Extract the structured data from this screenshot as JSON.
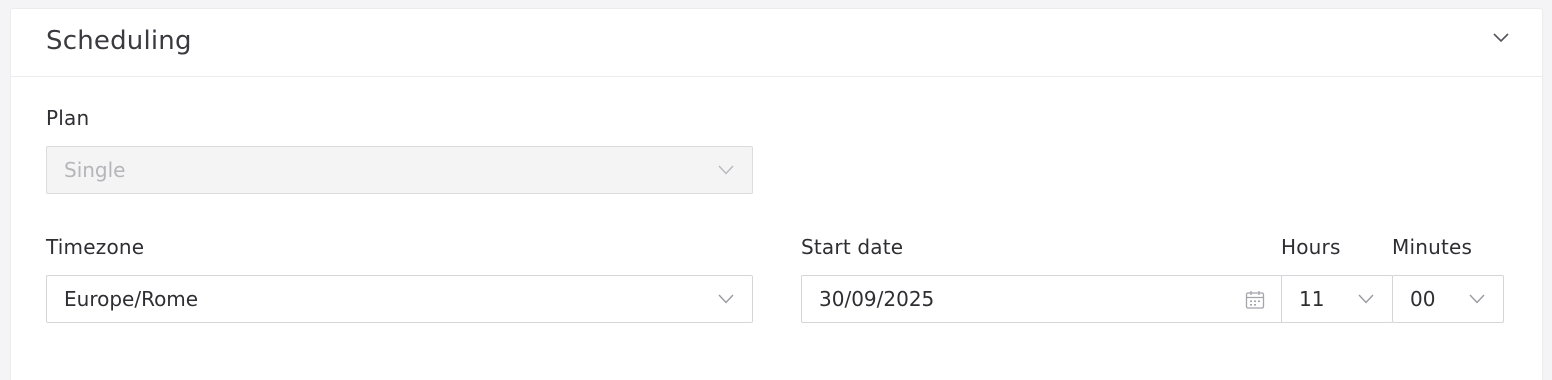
{
  "section": {
    "title": "Scheduling",
    "toggle_icon": "chevron-down-icon"
  },
  "plan": {
    "label": "Plan",
    "value": "Single",
    "disabled": true
  },
  "timezone": {
    "label": "Timezone",
    "value": "Europe/Rome"
  },
  "start_date": {
    "label": "Start date",
    "value": "30/09/2025",
    "icon": "calendar-icon"
  },
  "hours": {
    "label": "Hours",
    "value": "11"
  },
  "minutes": {
    "label": "Minutes",
    "value": "00"
  },
  "colors": {
    "border": "#d6d6da",
    "disabled_bg": "#f4f4f4",
    "disabled_text": "#b5b5ba",
    "text": "#2e2e33",
    "icon": "#9a9aa0"
  }
}
